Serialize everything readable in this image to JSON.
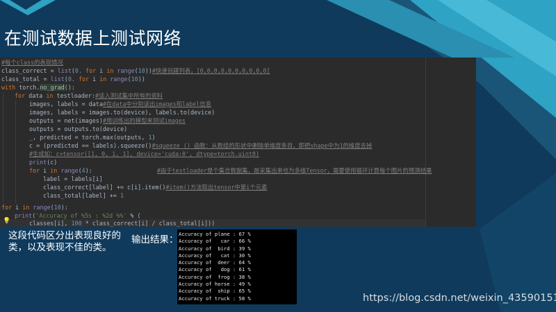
{
  "slide": {
    "title": "在测试数据上测试网络",
    "note_left": "这段代码区分出表现良好的类，以及表现不佳的类。",
    "note_output": "输出结果：",
    "watermark": "https://blog.csdn.net/weixin_43590151"
  },
  "theme": {
    "background": "#0f3a5c",
    "accent_teal": "#2ea3c4",
    "code_bg": "#2b2b2b",
    "output_bg": "#000000"
  },
  "code": {
    "l0": {
      "cmt": "#每个class的表现情况"
    },
    "l1": {
      "a": "class_correct = ",
      "fn1": "list",
      "b": "(",
      "n1": "0.",
      "k1": " for ",
      "c": "i ",
      "k2": "in ",
      "fn2": "range",
      "d": "(",
      "n2": "10",
      "e": "))",
      "cmt": "#快速创建列表，[0,0,0,0,0,0,0,0,0,0]"
    },
    "l2": {
      "a": "class_total = ",
      "fn1": "list",
      "b": "(",
      "n1": "0.",
      "k1": " for ",
      "c": "i ",
      "k2": "in ",
      "fn2": "range",
      "d": "(",
      "n2": "10",
      "e": "))"
    },
    "l3": {
      "k1": "with ",
      "a": "torch.",
      "hl": "no_grad",
      "b": "():"
    },
    "l4": {
      "k1": "for ",
      "a": "data ",
      "k2": "in ",
      "b": "testloader:",
      "cmt": "#读入测试集中所有的资料"
    },
    "l5": {
      "a": "images, labels = data",
      "cmt": "#在data中分别读出images和label信息"
    },
    "l6": {
      "a": "images, labels = images.to(device), labels.to(device)"
    },
    "l7": {
      "a": "outputs = net(images)",
      "cmt": "#用训练出的模型来测试images"
    },
    "l8": {
      "a": "outputs = outputs.to(device)"
    },
    "l9": {
      "a": "_, predicted = torch.max(outputs, ",
      "n1": "1",
      "b": ")"
    },
    "l10": {
      "a": "c = (predicted == labels).squeeze()",
      "cmt": "#squeeze () 函数：从数组的形状中删除单维度条目，即把shape中为1的维度去掉"
    },
    "l11": {
      "cmt": "#生成如：c=tensor([1, 0, 1, 1], device='cuda:0', dtype=torch.uint8)"
    },
    "l12": {
      "fn1": "print",
      "a": "(c)"
    },
    "l13": {
      "k1": "for ",
      "a": "i ",
      "k2": "in ",
      "fn1": "range",
      "b": "(",
      "n1": "4",
      "c": "):",
      "cmt": "#由于testloader是个集合数据集，故采集出来也为多维Tensor，需要使用循环计算每个图片的预测结果"
    },
    "l14": {
      "a": "label = labels[i]"
    },
    "l15": {
      "a": "class_correct[label] += c[i].item()",
      "cmt": "#item()方法取出tensor中第i个元素"
    },
    "l16": {
      "a": "class_total[label] += ",
      "n1": "1"
    },
    "l17": {
      "k1": "for ",
      "a": "i ",
      "k2": "in ",
      "fn1": "range",
      "b": "(",
      "n1": "10",
      "c": "):"
    },
    "l18": {
      "fn1": "print",
      "a": "(",
      "str": "'Accuracy of %5s : %2d %%'",
      "b": " % ("
    },
    "l19": {
      "a": "classes[i], ",
      "n1": "100",
      "b": " * class_correct[i] / class_total[i]))"
    }
  },
  "output": [
    "Accuracy of plane : 67 %",
    "Accuracy of   car : 66 %",
    "Accuracy of  bird : 39 %",
    "Accuracy of   cat : 30 %",
    "Accuracy of  deer : 64 %",
    "Accuracy of   dog : 61 %",
    "Accuracy of  frog : 38 %",
    "Accuracy of horse : 49 %",
    "Accuracy of  ship : 65 %",
    "Accuracy of truck : 58 %"
  ]
}
